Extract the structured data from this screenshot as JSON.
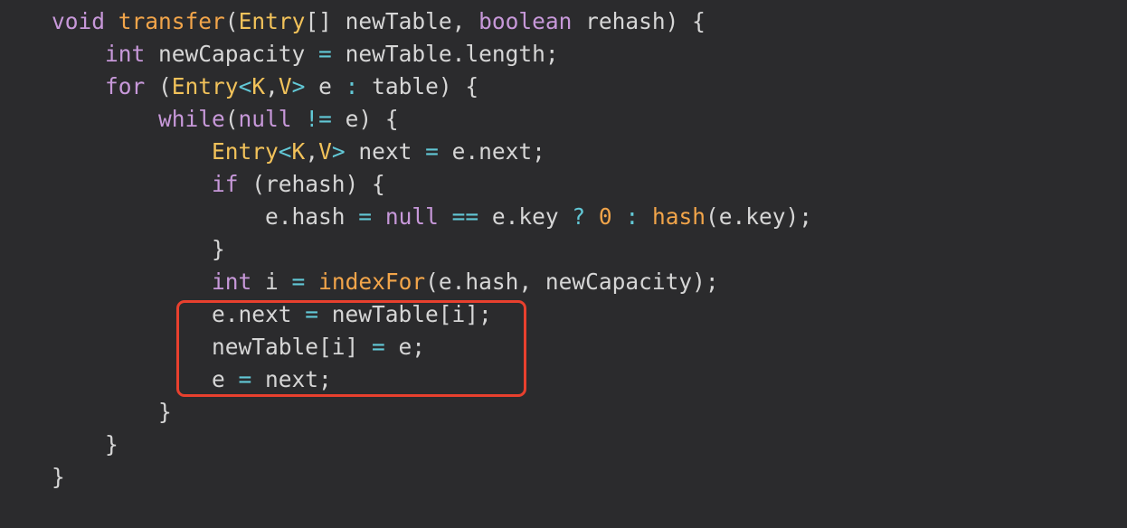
{
  "editor": {
    "lines": [
      {
        "indent": "",
        "tokens": [
          {
            "text": "void",
            "kind": "kw"
          },
          {
            "text": " ",
            "kind": "plain"
          },
          {
            "text": "transfer",
            "kind": "fn"
          },
          {
            "text": "(",
            "kind": "plain"
          },
          {
            "text": "Entry",
            "kind": "type"
          },
          {
            "text": "[] newTable, ",
            "kind": "plain"
          },
          {
            "text": "boolean",
            "kind": "kw"
          },
          {
            "text": " rehash) {",
            "kind": "plain"
          }
        ]
      },
      {
        "indent": "    ",
        "tokens": [
          {
            "text": "int",
            "kind": "kw"
          },
          {
            "text": " newCapacity ",
            "kind": "plain"
          },
          {
            "text": "=",
            "kind": "op"
          },
          {
            "text": " newTable.length;",
            "kind": "plain"
          }
        ]
      },
      {
        "indent": "    ",
        "tokens": [
          {
            "text": "for",
            "kind": "kw"
          },
          {
            "text": " (",
            "kind": "plain"
          },
          {
            "text": "Entry",
            "kind": "type"
          },
          {
            "text": "<",
            "kind": "op"
          },
          {
            "text": "K",
            "kind": "type"
          },
          {
            "text": ",",
            "kind": "plain"
          },
          {
            "text": "V",
            "kind": "type"
          },
          {
            "text": ">",
            "kind": "op"
          },
          {
            "text": " e ",
            "kind": "plain"
          },
          {
            "text": ":",
            "kind": "op"
          },
          {
            "text": " table) {",
            "kind": "plain"
          }
        ]
      },
      {
        "indent": "        ",
        "tokens": [
          {
            "text": "while",
            "kind": "kw"
          },
          {
            "text": "(",
            "kind": "plain"
          },
          {
            "text": "null",
            "kind": "kw"
          },
          {
            "text": " ",
            "kind": "plain"
          },
          {
            "text": "!=",
            "kind": "op"
          },
          {
            "text": " e) {",
            "kind": "plain"
          }
        ]
      },
      {
        "indent": "            ",
        "tokens": [
          {
            "text": "Entry",
            "kind": "type"
          },
          {
            "text": "<",
            "kind": "op"
          },
          {
            "text": "K",
            "kind": "type"
          },
          {
            "text": ",",
            "kind": "plain"
          },
          {
            "text": "V",
            "kind": "type"
          },
          {
            "text": ">",
            "kind": "op"
          },
          {
            "text": " next ",
            "kind": "plain"
          },
          {
            "text": "=",
            "kind": "op"
          },
          {
            "text": " e.next;",
            "kind": "plain"
          }
        ]
      },
      {
        "indent": "            ",
        "tokens": [
          {
            "text": "if",
            "kind": "kw"
          },
          {
            "text": " (rehash) {",
            "kind": "plain"
          }
        ]
      },
      {
        "indent": "                ",
        "tokens": [
          {
            "text": "e.hash ",
            "kind": "plain"
          },
          {
            "text": "=",
            "kind": "op"
          },
          {
            "text": " ",
            "kind": "plain"
          },
          {
            "text": "null",
            "kind": "kw"
          },
          {
            "text": " ",
            "kind": "plain"
          },
          {
            "text": "==",
            "kind": "op"
          },
          {
            "text": " e.key ",
            "kind": "plain"
          },
          {
            "text": "?",
            "kind": "op"
          },
          {
            "text": " ",
            "kind": "plain"
          },
          {
            "text": "0",
            "kind": "num"
          },
          {
            "text": " ",
            "kind": "plain"
          },
          {
            "text": ":",
            "kind": "op"
          },
          {
            "text": " ",
            "kind": "plain"
          },
          {
            "text": "hash",
            "kind": "fn"
          },
          {
            "text": "(e.key);",
            "kind": "plain"
          }
        ]
      },
      {
        "indent": "            ",
        "tokens": [
          {
            "text": "}",
            "kind": "plain"
          }
        ]
      },
      {
        "indent": "            ",
        "tokens": [
          {
            "text": "int",
            "kind": "kw"
          },
          {
            "text": " i ",
            "kind": "plain"
          },
          {
            "text": "=",
            "kind": "op"
          },
          {
            "text": " ",
            "kind": "plain"
          },
          {
            "text": "indexFor",
            "kind": "fn"
          },
          {
            "text": "(e.hash, newCapacity);",
            "kind": "plain"
          }
        ]
      },
      {
        "indent": "            ",
        "tokens": [
          {
            "text": "e.next ",
            "kind": "plain"
          },
          {
            "text": "=",
            "kind": "op"
          },
          {
            "text": " newTable[i];",
            "kind": "plain"
          }
        ]
      },
      {
        "indent": "            ",
        "tokens": [
          {
            "text": "newTable[i] ",
            "kind": "plain"
          },
          {
            "text": "=",
            "kind": "op"
          },
          {
            "text": " e;",
            "kind": "plain"
          }
        ]
      },
      {
        "indent": "            ",
        "tokens": [
          {
            "text": "e ",
            "kind": "plain"
          },
          {
            "text": "=",
            "kind": "op"
          },
          {
            "text": " next;",
            "kind": "plain"
          }
        ]
      },
      {
        "indent": "        ",
        "tokens": [
          {
            "text": "}",
            "kind": "plain"
          }
        ]
      },
      {
        "indent": "    ",
        "tokens": [
          {
            "text": "}",
            "kind": "plain"
          }
        ]
      },
      {
        "indent": "",
        "tokens": [
          {
            "text": "}",
            "kind": "plain"
          }
        ]
      }
    ]
  },
  "highlight": {
    "color": "#e8402e",
    "from_line": 10,
    "to_line": 12
  },
  "colors": {
    "background": "#2b2b2d",
    "keyword": "#c798d9",
    "type": "#f2c25a",
    "function": "#f2a54a",
    "operator": "#62c8d6",
    "number": "#f2a54a",
    "text": "#d6d6d6"
  }
}
